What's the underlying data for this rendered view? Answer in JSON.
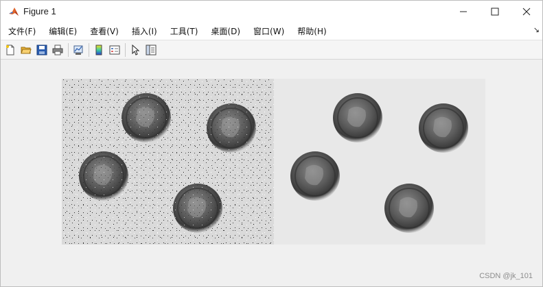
{
  "window": {
    "title": "Figure 1"
  },
  "controls": {
    "minimize": "—",
    "maximize": "☐",
    "close": "✕"
  },
  "menu": {
    "items": [
      {
        "label": "文件(F)"
      },
      {
        "label": "编辑(E)"
      },
      {
        "label": "查看(V)"
      },
      {
        "label": "插入(I)"
      },
      {
        "label": "工具(T)"
      },
      {
        "label": "桌面(D)"
      },
      {
        "label": "窗口(W)"
      },
      {
        "label": "帮助(H)"
      }
    ],
    "overflow_arrow": "↘"
  },
  "toolbar": {
    "icons": [
      "new-figure-icon",
      "open-folder-icon",
      "save-icon",
      "print-icon",
      "link-plot-icon",
      "colorbar-icon",
      "legend-icon",
      "edit-pointer-icon",
      "property-inspector-icon"
    ]
  },
  "figure": {
    "panels": [
      "noisy coins image",
      "filtered coins image"
    ]
  },
  "watermark": {
    "text": "CSDN @jk_101"
  },
  "colors": {
    "titlebar_bg": "#ffffff",
    "figure_bg": "#f0f0f0",
    "accent_folder": "#e8b33a",
    "accent_save": "#2a5db0"
  }
}
